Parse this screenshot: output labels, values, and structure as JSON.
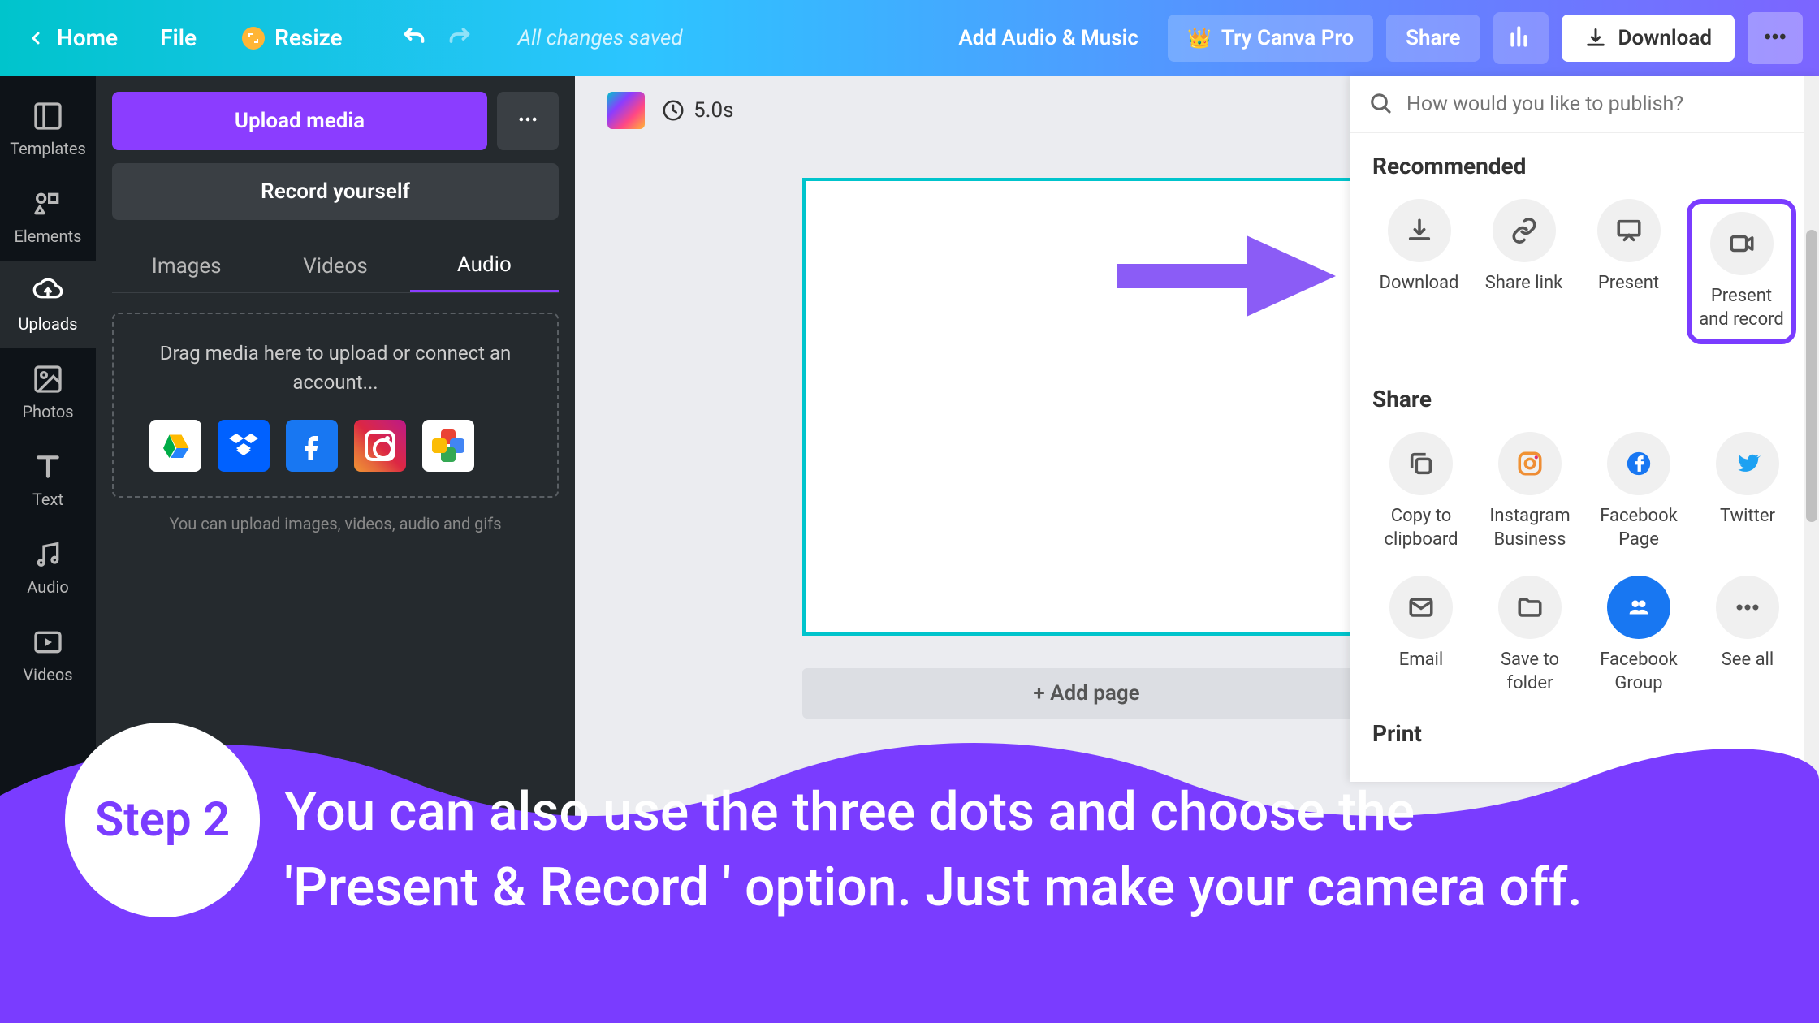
{
  "topbar": {
    "home": "Home",
    "file": "File",
    "resize": "Resize",
    "saved": "All changes saved",
    "audio_music": "Add Audio & Music",
    "try_pro": "Try Canva Pro",
    "share": "Share",
    "download": "Download"
  },
  "sidebar": {
    "items": [
      {
        "label": "Templates"
      },
      {
        "label": "Elements"
      },
      {
        "label": "Uploads"
      },
      {
        "label": "Photos"
      },
      {
        "label": "Text"
      },
      {
        "label": "Audio"
      },
      {
        "label": "Videos"
      }
    ]
  },
  "uploads_panel": {
    "upload_media": "Upload media",
    "record_yourself": "Record yourself",
    "tabs": {
      "images": "Images",
      "videos": "Videos",
      "audio": "Audio"
    },
    "dropzone": "Drag media here to upload or connect an account...",
    "hint": "You can upload images, videos, audio and gifs"
  },
  "canvas": {
    "duration": "5.0s",
    "add_page": "+ Add page"
  },
  "publish": {
    "placeholder": "How would you like to publish?",
    "recommended_title": "Recommended",
    "recommended": [
      {
        "label": "Download"
      },
      {
        "label": "Share link"
      },
      {
        "label": "Present"
      },
      {
        "label": "Present and record"
      }
    ],
    "share_title": "Share",
    "share_row1": [
      {
        "label": "Copy to clipboard"
      },
      {
        "label": "Instagram Business"
      },
      {
        "label": "Facebook Page"
      },
      {
        "label": "Twitter"
      }
    ],
    "share_row2": [
      {
        "label": "Email"
      },
      {
        "label": "Save to folder"
      },
      {
        "label": "Facebook Group"
      },
      {
        "label": "See all"
      }
    ],
    "print_title": "Print"
  },
  "annotation": {
    "step": "Step 2",
    "text_line1": "You can also use the three dots and choose the",
    "text_line2": "'Present & Record ' option. Just make your camera off."
  }
}
